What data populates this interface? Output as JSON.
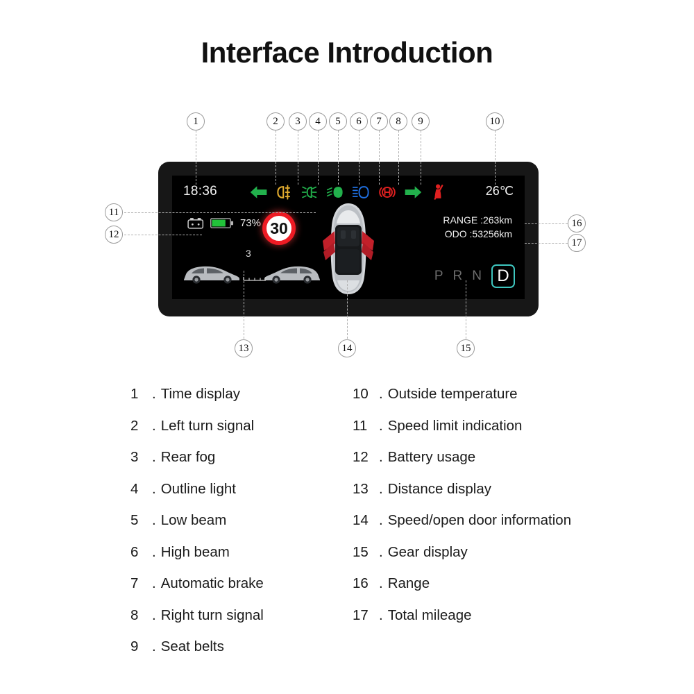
{
  "page": {
    "title": "Interface Introduction"
  },
  "cluster": {
    "time": "18:36",
    "outside_temperature": "26℃",
    "speed_limit": "30",
    "battery_percent": "73%",
    "range_label": "RANGE :263km",
    "odo_label": "ODO :53256km",
    "distance_value": "3",
    "gear": {
      "options": [
        "P",
        "R",
        "N",
        "D"
      ],
      "selected": "D",
      "active_color": "#3ec6bf",
      "inactive_color": "#6d6d6d"
    },
    "telltales": [
      {
        "name": "left-turn-signal-icon",
        "color": "#22b14c"
      },
      {
        "name": "rear-fog-light-icon",
        "color": "#e0aa2e"
      },
      {
        "name": "outline-light-icon",
        "color": "#22b14c"
      },
      {
        "name": "low-beam-icon",
        "color": "#22b14c"
      },
      {
        "name": "high-beam-icon",
        "color": "#1f6fe0"
      },
      {
        "name": "automatic-brake-icon",
        "color": "#e02020"
      },
      {
        "name": "right-turn-signal-icon",
        "color": "#22b14c"
      },
      {
        "name": "seat-belt-icon",
        "color": "#e02020"
      }
    ]
  },
  "callouts": [
    {
      "id": "1",
      "label": "1"
    },
    {
      "id": "2",
      "label": "2"
    },
    {
      "id": "3",
      "label": "3"
    },
    {
      "id": "4",
      "label": "4"
    },
    {
      "id": "5",
      "label": "5"
    },
    {
      "id": "6",
      "label": "6"
    },
    {
      "id": "7",
      "label": "7"
    },
    {
      "id": "8",
      "label": "8"
    },
    {
      "id": "9",
      "label": "9"
    },
    {
      "id": "10",
      "label": "10"
    },
    {
      "id": "11",
      "label": "11"
    },
    {
      "id": "12",
      "label": "12"
    },
    {
      "id": "13",
      "label": "13"
    },
    {
      "id": "14",
      "label": "14"
    },
    {
      "id": "15",
      "label": "15"
    },
    {
      "id": "16",
      "label": "16"
    },
    {
      "id": "17",
      "label": "17"
    }
  ],
  "legend": {
    "separator": ".",
    "left": [
      {
        "num": "1",
        "text": "Time display"
      },
      {
        "num": "2",
        "text": "Left turn signal"
      },
      {
        "num": "3",
        "text": "Rear fog"
      },
      {
        "num": "4",
        "text": "Outline light"
      },
      {
        "num": "5",
        "text": "Low beam"
      },
      {
        "num": "6",
        "text": "High beam"
      },
      {
        "num": "7",
        "text": "Automatic brake"
      },
      {
        "num": "8",
        "text": "Right turn signal"
      },
      {
        "num": "9",
        "text": "Seat belts"
      }
    ],
    "right": [
      {
        "num": "10",
        "text": "Outside temperature"
      },
      {
        "num": "11",
        "text": "Speed limit indication"
      },
      {
        "num": "12",
        "text": "Battery usage"
      },
      {
        "num": "13",
        "text": "Distance display"
      },
      {
        "num": "14",
        "text": "Speed/open door information"
      },
      {
        "num": "15",
        "text": "Gear display"
      },
      {
        "num": "16",
        "text": "Range"
      },
      {
        "num": "17",
        "text": "Total mileage"
      }
    ]
  }
}
